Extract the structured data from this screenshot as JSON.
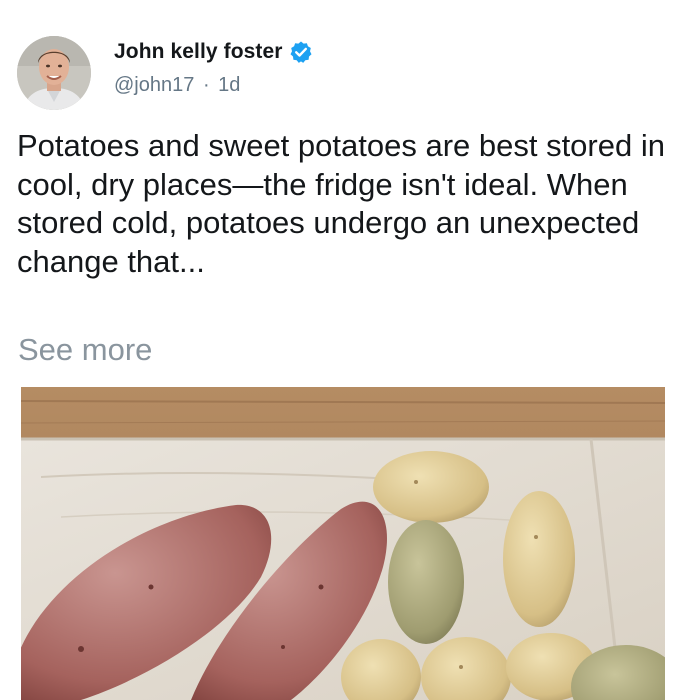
{
  "author": {
    "name": "John kelly foster",
    "handle": "@john17",
    "separator": "·",
    "time": "1d",
    "verified_icon": "verified-badge-icon",
    "verified_color": "#1da1f2"
  },
  "tweet": {
    "text": "Potatoes and sweet potatoes are best stored in cool, dry places—the fridge isn't ideal. When stored cold, potatoes undergo an unexpected change that...",
    "see_more": "See more"
  },
  "colors": {
    "text": "#14171a",
    "muted": "#657786",
    "see_more": "#8a959e"
  }
}
